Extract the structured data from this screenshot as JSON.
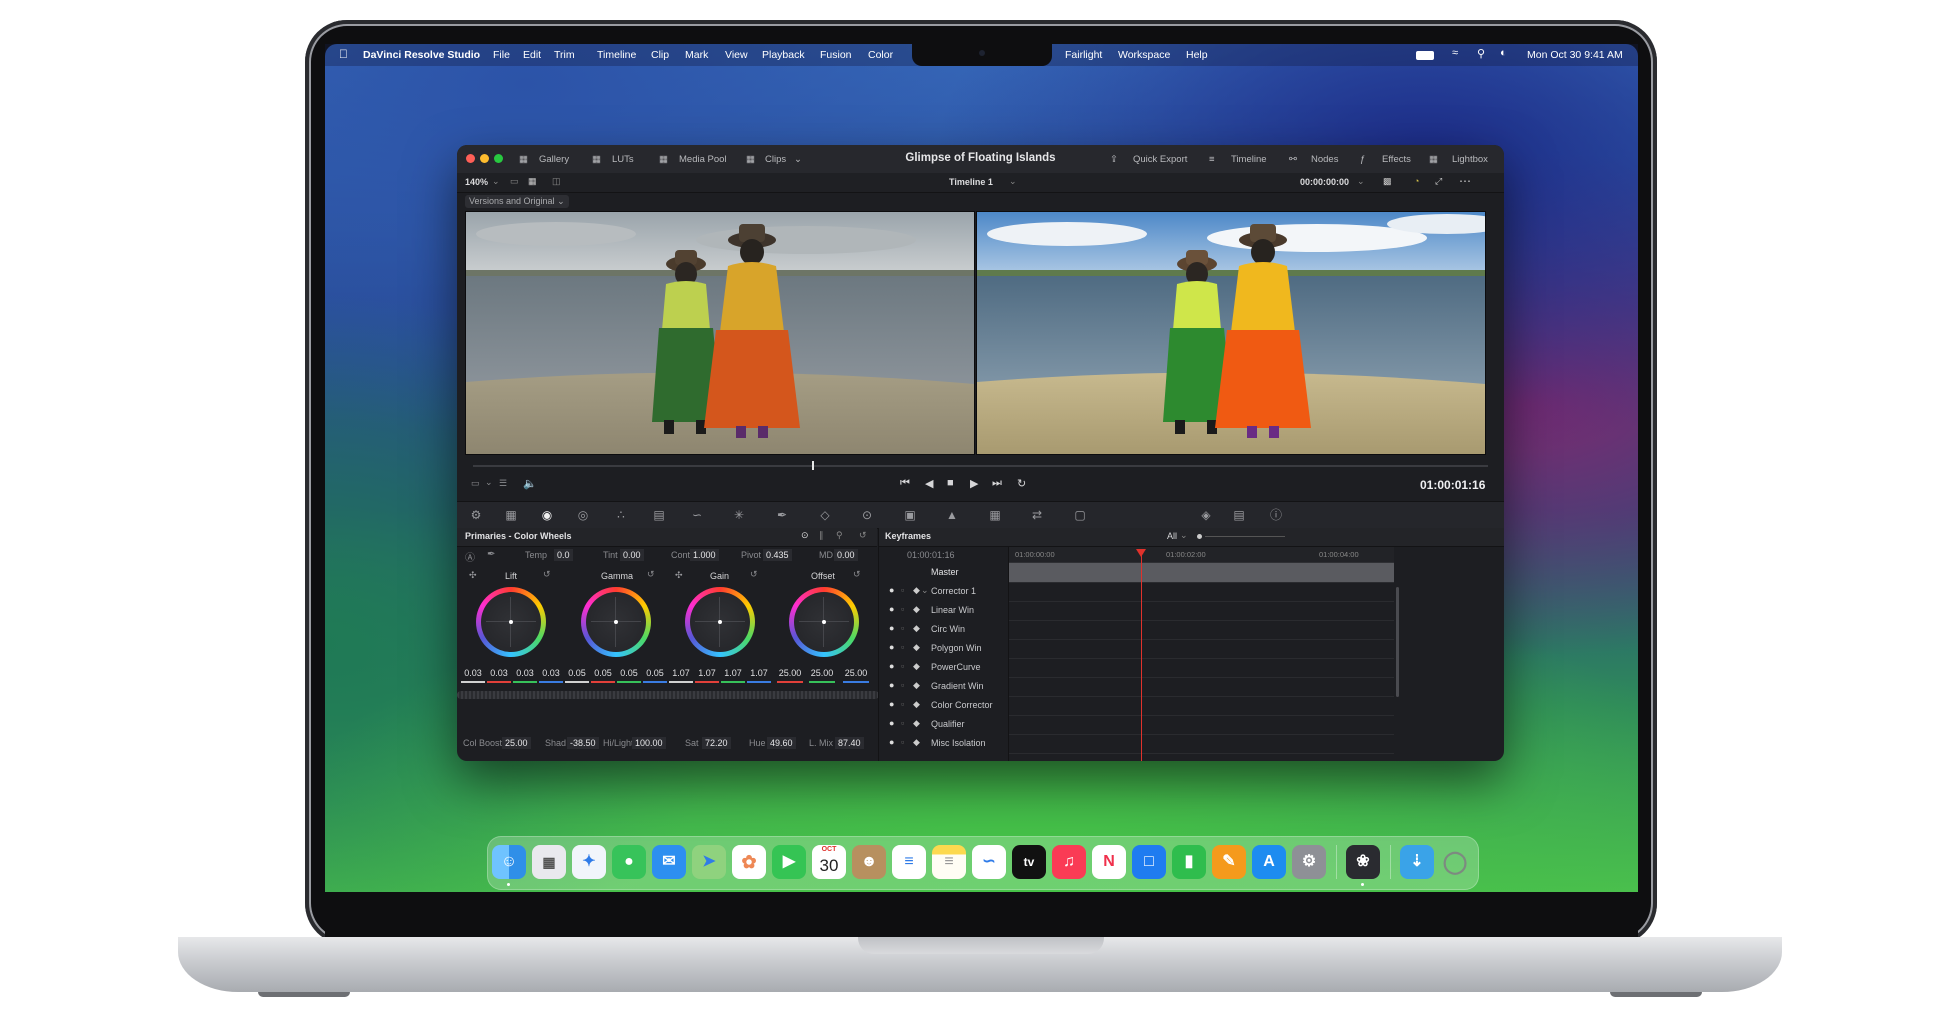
{
  "menubar": {
    "apple_icon": "apple-icon",
    "app_name": "DaVinci Resolve Studio",
    "menus": [
      "File",
      "Edit",
      "Trim",
      "Timeline",
      "Clip",
      "Mark",
      "View",
      "Playback",
      "Fusion",
      "Color",
      "Fairlight",
      "Workspace",
      "Help"
    ],
    "clock": "Mon Oct 30  9:41 AM",
    "status_icons": [
      "battery-icon",
      "wifi-icon",
      "search-icon",
      "control-center-icon"
    ]
  },
  "window": {
    "title": "Glimpse of Floating Islands",
    "left_tabs": [
      "Gallery",
      "LUTs",
      "Media Pool",
      "Clips"
    ],
    "right_tabs": [
      "Quick Export",
      "Timeline",
      "Nodes",
      "Effects",
      "Lightbox"
    ],
    "zoom": "140%",
    "timeline_name": "Timeline 1",
    "timecode_top": "00:00:00:00",
    "versions_dropdown": "Versions and Original",
    "playback_timecode": "01:00:01:16"
  },
  "primaries": {
    "title": "Primaries - Color Wheels",
    "temp_label": "Temp",
    "temp_value": "0.0",
    "tint_label": "Tint",
    "tint_value": "0.00",
    "cont_label": "Cont",
    "cont_value": "1.000",
    "pivot_label": "Pivot",
    "pivot_value": "0.435",
    "md_label": "MD",
    "md_value": "0.00",
    "wheels": [
      {
        "name": "Lift",
        "values": [
          "0.03",
          "0.03",
          "0.03",
          "0.03"
        ]
      },
      {
        "name": "Gamma",
        "values": [
          "0.05",
          "0.05",
          "0.05",
          "0.05"
        ]
      },
      {
        "name": "Gain",
        "values": [
          "1.07",
          "1.07",
          "1.07",
          "1.07"
        ]
      },
      {
        "name": "Offset",
        "values": [
          "25.00",
          "25.00",
          "25.00"
        ]
      }
    ],
    "colboost_label": "Col Boost",
    "colboost_value": "25.00",
    "shad_label": "Shad",
    "shad_value": "-38.50",
    "hilight_label": "Hi/Light",
    "hilight_value": "100.00",
    "sat_label": "Sat",
    "sat_value": "72.20",
    "hue_label": "Hue",
    "hue_value": "49.60",
    "lmix_label": "L. Mix",
    "lmix_value": "87.40"
  },
  "keyframes": {
    "title": "Keyframes",
    "filter": "All",
    "current_time": "01:00:01:16",
    "ruler": [
      "01:00:00:00",
      "01:00:02:00",
      "01:00:04:00"
    ],
    "rows": [
      "Master",
      "Corrector 1",
      "Linear Win",
      "Circ Win",
      "Polygon Win",
      "PowerCurve",
      "Gradient Win",
      "Color Corrector",
      "Qualifier",
      "Misc Isolation"
    ]
  },
  "dock": {
    "items": [
      "finder-icon",
      "launchpad-icon",
      "safari-icon",
      "messages-icon",
      "mail-icon",
      "maps-icon",
      "photos-icon",
      "facetime-icon",
      "calendar-icon",
      "contacts-icon",
      "reminders-icon",
      "notes-icon",
      "freeform-icon",
      "tv-icon",
      "music-icon",
      "news-icon",
      "keynote-icon",
      "numbers-icon",
      "pages-icon",
      "app-store-icon",
      "system-settings-icon",
      "davinci-resolve-icon",
      "downloads-folder-icon",
      "trash-icon"
    ],
    "calendar_month": "OCT",
    "calendar_day": "30",
    "tv_label": "tv"
  }
}
